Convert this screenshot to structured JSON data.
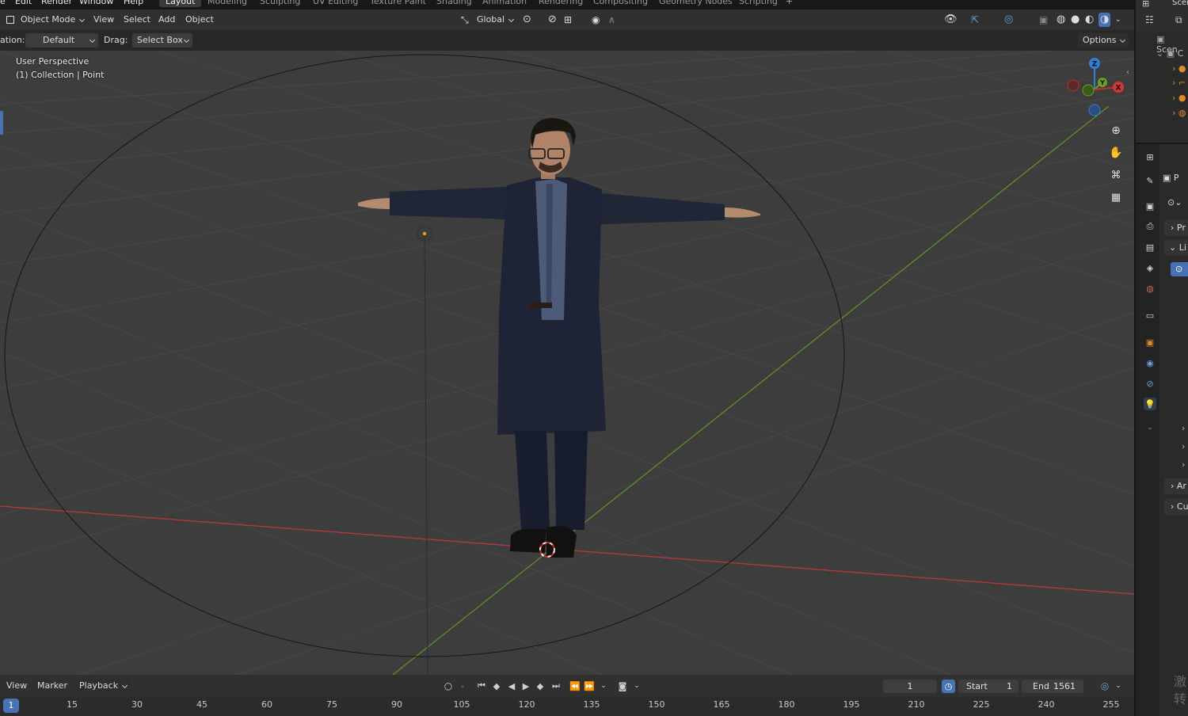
{
  "top_menu": [
    "e",
    "Edit",
    "Render",
    "Window",
    "Help"
  ],
  "workspaces": [
    "Layout",
    "Modeling",
    "Sculpting",
    "UV Editing",
    "Texture Paint",
    "Shading",
    "Animation",
    "Rendering",
    "Compositing",
    "Geometry Nodes",
    "Scripting"
  ],
  "active_workspace": "Layout",
  "header": {
    "mode": "Object Mode",
    "view": "View",
    "select": "Select",
    "add": "Add",
    "object": "Object",
    "orientation": "Global"
  },
  "tool_header": {
    "orientation_label": "ation:",
    "orientation_value": "Default",
    "drag_label": "Drag:",
    "drag_value": "Select Box",
    "options": "Options"
  },
  "viewport": {
    "perspective": "User Perspective",
    "collection": "(1) Collection | Point"
  },
  "gizmo": {
    "z": "Z",
    "y": "Y",
    "x": "X"
  },
  "outliner": {
    "title": "Scen",
    "rows": [
      "C",
      "",
      "",
      "",
      ""
    ]
  },
  "properties": {
    "tabs": [
      "P",
      "Pr",
      "Li",
      "Ar",
      "Cu"
    ]
  },
  "timeline_header": {
    "view": "View",
    "marker": "Marker",
    "playback": "Playback",
    "current_frame": "1",
    "start_label": "Start",
    "start_value": "1",
    "end_label": "End",
    "end_value": "1561"
  },
  "timeline": {
    "current": "1",
    "ticks": [
      "15",
      "30",
      "45",
      "60",
      "75",
      "90",
      "105",
      "120",
      "135",
      "150",
      "165",
      "180",
      "195",
      "210",
      "225",
      "240",
      "255"
    ]
  },
  "watermark": "激\n转",
  "colors": {
    "x_axis": "#c03030",
    "y_axis": "#6aa023",
    "z_axis": "#2e7fd8",
    "accent": "#4772b3"
  }
}
